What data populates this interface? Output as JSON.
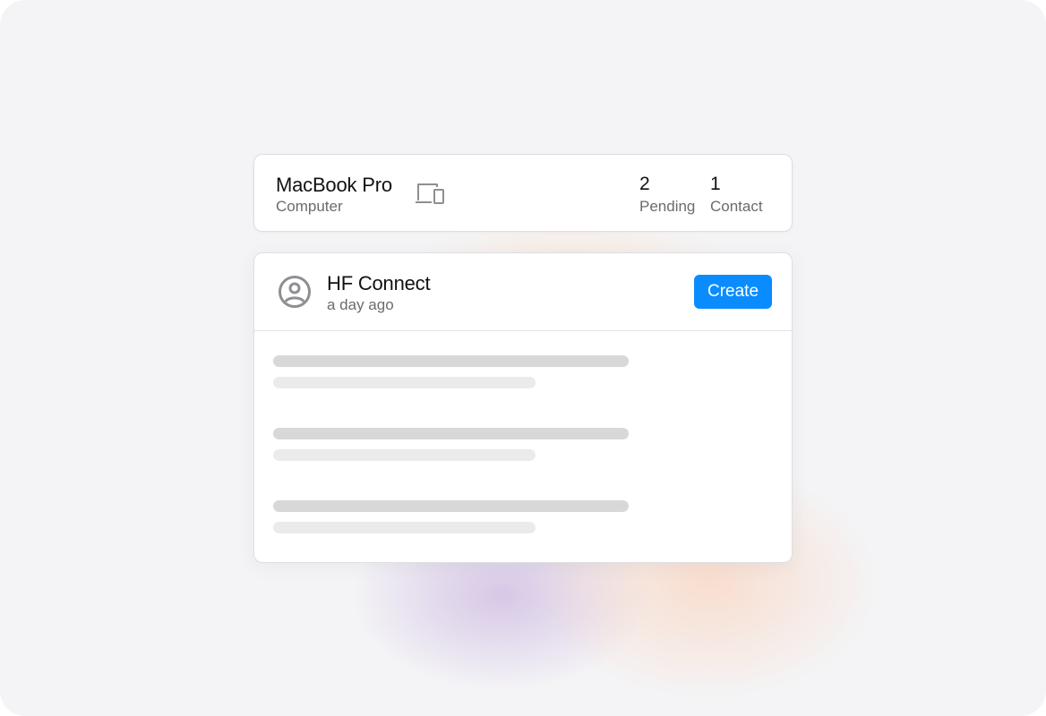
{
  "device": {
    "name": "MacBook Pro",
    "type": "Computer",
    "icon": "devices-icon"
  },
  "stats": {
    "pending_count": "2",
    "pending_label": "Pending",
    "contact_count": "1",
    "contact_label": "Contact"
  },
  "connection": {
    "icon": "user-circle-icon",
    "title": "HF Connect",
    "time": "a day ago",
    "create_label": "Create"
  },
  "skeleton_rows": 3,
  "colors": {
    "accent": "#0a8cff",
    "background": "#f4f4f6",
    "text_primary": "#111111",
    "text_secondary": "#6b6b70",
    "skeleton_dark": "#d8d8d8",
    "skeleton_light": "#ebebeb"
  }
}
